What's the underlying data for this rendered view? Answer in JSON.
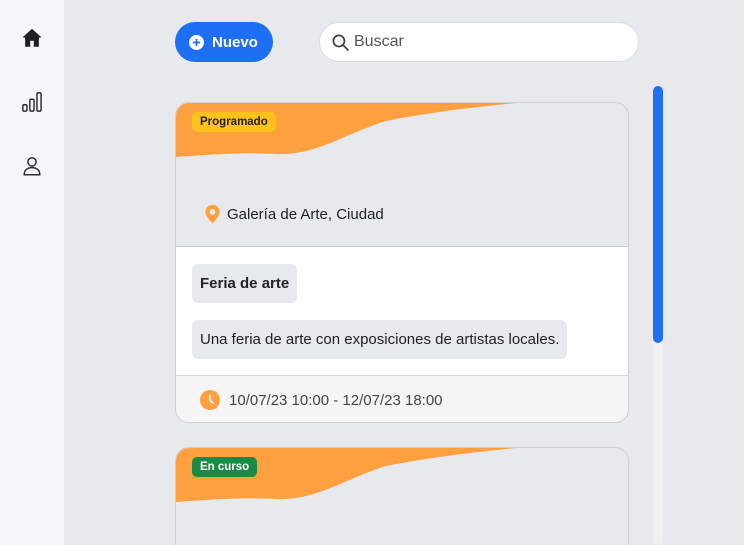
{
  "sidebar": {
    "items": [
      {
        "icon": "home-icon"
      },
      {
        "icon": "bar-chart-icon"
      },
      {
        "icon": "user-icon"
      }
    ]
  },
  "toolbar": {
    "new_label": "Nuevo",
    "search_placeholder": "Buscar",
    "search_value": ""
  },
  "colors": {
    "accent": "#1f6ff5",
    "wave": "#ffa040",
    "status_scheduled": "#ffc21a",
    "status_in_progress": "#1b8a45"
  },
  "scroll": {
    "visible_fraction": 0.56
  },
  "events": [
    {
      "status": "Programado",
      "location": "Galería de Arte, Ciudad",
      "title": "Feria de arte",
      "description": "Una feria de arte con exposiciones de artistas locales.",
      "datetime": "10/07/23 10:00 - 12/07/23 18:00"
    },
    {
      "status": "En curso"
    }
  ]
}
